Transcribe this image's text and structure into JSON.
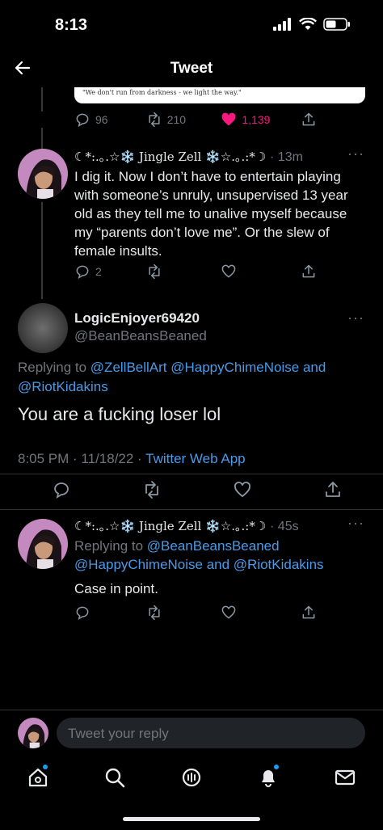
{
  "status_bar": {
    "time": "8:13"
  },
  "header": {
    "title": "Tweet"
  },
  "quoted_card": {
    "caption": "\"We don't run from darkness - we light the way.\""
  },
  "parent_tweet_actions": {
    "replies": "96",
    "retweets": "210",
    "likes": "1,139"
  },
  "tweet1": {
    "display_name": "☾*:.｡.☆❄️ Jingle Zell ❄️☆.｡.:*☽",
    "time": "· 13m",
    "text": "I dig it. Now I don’t have to entertain playing with someone’s unruly, unsupervised 13 year old as they tell me to unalive myself because my “parents don’t love me”. Or the slew of female insults.",
    "replies": "2"
  },
  "main_tweet": {
    "display_name": "LogicEnjoyer69420",
    "handle": "@BeanBeansBeaned",
    "replying_prefix": "Replying to",
    "replying_to": "@ZellBellArt @HappyChimeNoise and",
    "replying_to_2": "@RiotKidakins",
    "text": "You are a fucking loser lol",
    "timestamp": "8:05 PM · 11/18/22 ·",
    "source": "Twitter Web App"
  },
  "reply_tweet": {
    "display_name": "☾*:.｡.☆❄️ Jingle Zell ❄️☆.｡.:*☽",
    "time": "· 45s",
    "replying_prefix": "Replying to",
    "replying_to": "@BeanBeansBeaned",
    "replying_to_2": "@HappyChimeNoise and @RiotKidakins",
    "text": "Case in point."
  },
  "composer": {
    "placeholder": "Tweet your reply"
  },
  "tabbar": [
    "home-icon",
    "search-icon",
    "spaces-icon",
    "notifications-icon",
    "messages-icon"
  ],
  "colors": {
    "accent": "#1d9bf0",
    "like": "#f91880",
    "link": "#4a9ae8"
  }
}
